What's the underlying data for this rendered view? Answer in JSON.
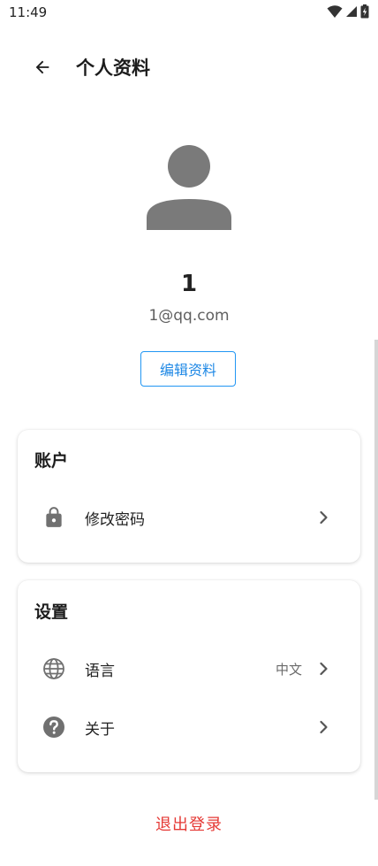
{
  "status_bar": {
    "time": "11:49"
  },
  "header": {
    "title": "个人资料"
  },
  "profile": {
    "name": "1",
    "email": "1@qq.com",
    "edit_button": "编辑资料"
  },
  "account_section": {
    "title": "账户",
    "items": [
      {
        "label": "修改密码",
        "icon": "lock-icon"
      }
    ]
  },
  "settings_section": {
    "title": "设置",
    "items": [
      {
        "label": "语言",
        "value": "中文",
        "icon": "globe-icon"
      },
      {
        "label": "关于",
        "icon": "help-icon"
      }
    ]
  },
  "logout_label": "退出登录",
  "colors": {
    "accent": "#1e88e5",
    "danger": "#e53935",
    "icon_gray": "#707070"
  }
}
